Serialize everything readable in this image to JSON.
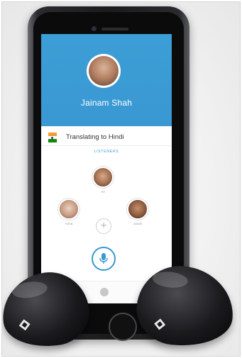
{
  "profile": {
    "name": "Jainam Shah"
  },
  "translation": {
    "label": "Translating to Hindi",
    "flag_icon": "india-flag-icon"
  },
  "listeners": {
    "header": "LISTENERS",
    "people": [
      {
        "name": "Ari"
      },
      {
        "name": "Anna"
      },
      {
        "name": "Jacob"
      }
    ]
  },
  "controls": {
    "add_icon": "plus-icon",
    "mic_icon": "microphone-icon"
  },
  "tabbar": {
    "items": [
      "home-icon",
      "translate-icon"
    ]
  },
  "colors": {
    "accent": "#3a98d2",
    "header_blue": "#3c9ed6",
    "earpiece": "#1a1a1d"
  }
}
